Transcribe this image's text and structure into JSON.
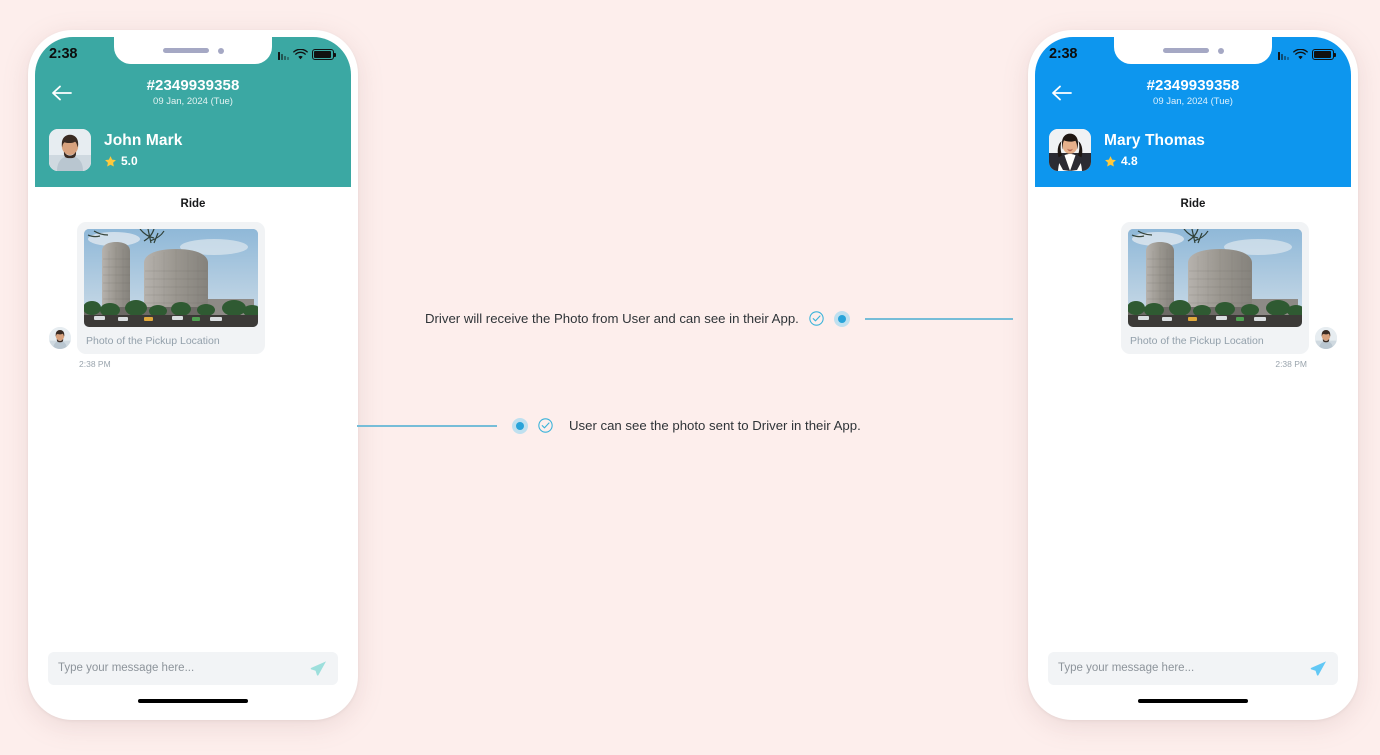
{
  "page": {
    "background_color": "#fdeeec"
  },
  "phones": [
    {
      "id": "driver-app",
      "accent_color": "#3ba8a3",
      "status_bar": {
        "time": "2:38",
        "wifi_icon": "wifi-icon",
        "battery_icon": "battery-icon",
        "signal_icon": "signal-icon"
      },
      "header": {
        "back_icon": "back-arrow-icon",
        "ride_id": "#2349939358",
        "ride_date": "09 Jan, 2024 (Tue)",
        "user_name": "John Mark",
        "rating": "5.0",
        "star_icon": "star-icon",
        "avatar": "avatar-john-mark"
      },
      "chat": {
        "day_label": "Ride",
        "message": {
          "direction": "incoming",
          "photo_alt": "photo-of-pickup-location",
          "caption": "Photo of the Pickup Location",
          "time": "2:38 PM",
          "avatar": "avatar-john-mark"
        }
      },
      "input": {
        "placeholder": "Type your message here...",
        "send_icon": "send-icon",
        "send_icon_color": "#9ddfdc"
      }
    },
    {
      "id": "user-app",
      "accent_color": "#0d96ee",
      "status_bar": {
        "time": "2:38",
        "wifi_icon": "wifi-icon",
        "battery_icon": "battery-icon",
        "signal_icon": "signal-icon"
      },
      "header": {
        "back_icon": "back-arrow-icon",
        "ride_id": "#2349939358",
        "ride_date": "09 Jan, 2024 (Tue)",
        "user_name": "Mary Thomas",
        "rating": "4.8",
        "star_icon": "star-icon",
        "avatar": "avatar-mary-thomas"
      },
      "chat": {
        "day_label": "Ride",
        "message": {
          "direction": "outgoing",
          "photo_alt": "photo-of-pickup-location",
          "caption": "Photo of the Pickup Location",
          "time": "2:38 PM",
          "avatar": "avatar-john-mark"
        }
      },
      "input": {
        "placeholder": "Type your message here...",
        "send_icon": "send-icon",
        "send_icon_color": "#62c8f5"
      }
    }
  ],
  "annotations": [
    {
      "id": "driver-annotation",
      "text": "Driver will receive the Photo from User and can see in their App.",
      "check_icon": "check-circle-icon",
      "marker_icon": "dot-marker-icon",
      "line_color": "#76bdd8",
      "marker_color": "#29a3d9"
    },
    {
      "id": "user-annotation",
      "text": "User can see the photo sent to Driver in their App.",
      "check_icon": "check-circle-icon",
      "marker_icon": "dot-marker-icon",
      "line_color": "#76bdd8",
      "marker_color": "#29a3d9"
    }
  ]
}
